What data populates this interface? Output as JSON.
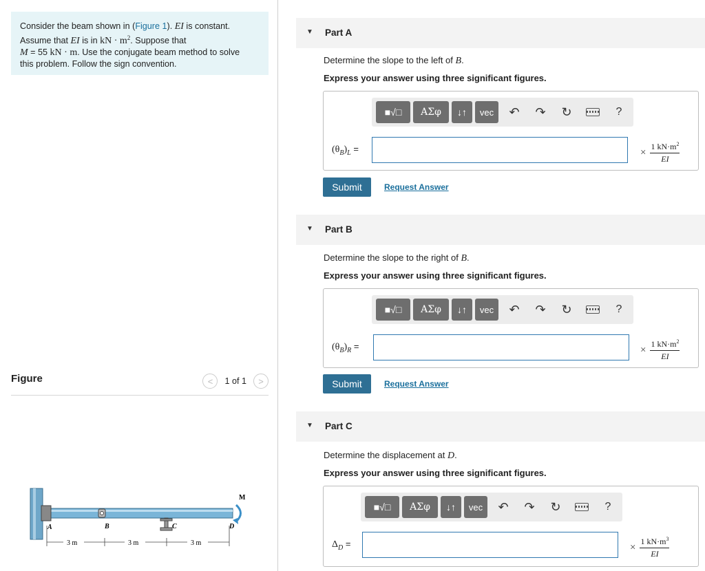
{
  "problem": {
    "t1": "Consider the beam shown in (",
    "figure_link": "Figure 1",
    "t2": "). ",
    "ei": "EI",
    "t3": " is constant.",
    "t4": "Assume that ",
    "ei2": "EI",
    "t5": " is in ",
    "unit_kNm2": "kN · m",
    "sup2": "2",
    "t6": ". Suppose that",
    "m_sym": "M",
    "t7": " = 55 ",
    "unit_kNm": "kN · m",
    "t8": ". Use the conjugate beam method to solve",
    "t9": "this problem. Follow the sign convention."
  },
  "figure": {
    "title": "Figure",
    "prev": "<",
    "next": ">",
    "pager": "1 of 1",
    "labels": {
      "A": "A",
      "B": "B",
      "C": "C",
      "D": "D",
      "M": "M"
    },
    "dims": [
      "3 m",
      "3 m",
      "3 m"
    ]
  },
  "toolbar": {
    "template": "■√□",
    "greek": "ΑΣφ",
    "arrows": "↓↑",
    "vec": "vec",
    "undo": "↶",
    "redo": "↷",
    "reset": "↻",
    "help": "?"
  },
  "parts": [
    {
      "title": "Part A",
      "q_text": "Determine the slope to the left of ",
      "q_var": "B",
      "q_end": ".",
      "instr": "Express your answer using three significant figures.",
      "label_sym": "(θ",
      "label_sub": "B",
      "label_close": ")",
      "label_sub2": "L",
      "label_eq": " =",
      "answer": "",
      "unit_num": "1 kN·m",
      "unit_exp": "2",
      "unit_den": "EI",
      "times": "×",
      "submit": "Submit",
      "request": "Request Answer"
    },
    {
      "title": "Part B",
      "q_text": "Determine the slope to the right of ",
      "q_var": "B",
      "q_end": ".",
      "instr": "Express your answer using three significant figures.",
      "label_sym": "(θ",
      "label_sub": "B",
      "label_close": ")",
      "label_sub2": "R",
      "label_eq": " =",
      "answer": "",
      "unit_num": "1 kN·m",
      "unit_exp": "2",
      "unit_den": "EI",
      "times": "×",
      "submit": "Submit",
      "request": "Request Answer"
    },
    {
      "title": "Part C",
      "q_text": "Determine the displacement at ",
      "q_var": "D",
      "q_end": ".",
      "instr": "Express your answer using three significant figures.",
      "label_sym": "Δ",
      "label_sub": "D",
      "label_eq": " =",
      "answer": "",
      "unit_num": "1 kN·m",
      "unit_exp": "3",
      "unit_den": "EI",
      "times": "×"
    }
  ]
}
